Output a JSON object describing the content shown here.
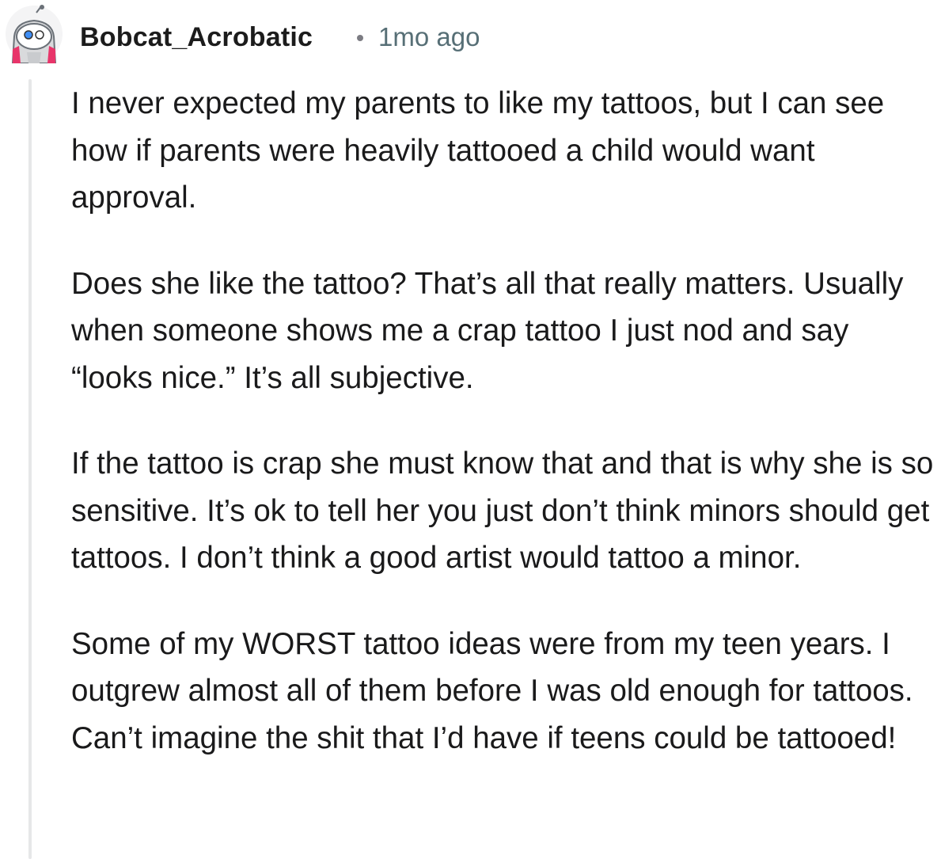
{
  "comment": {
    "username": "Bobcat_Acrobatic",
    "separator": "•",
    "timestamp": "1mo ago",
    "avatar_icon": "snoo-avatar-icon",
    "paragraphs": [
      "I never expected my parents to like my tattoos, but I can see how if parents were heavily tattooed a child would want approval.",
      "Does she like the tattoo? That’s all that really matters. Usually when someone shows me a crap tattoo I just nod and say “looks nice.” It’s all subjective.",
      "If the tattoo is crap she must know that and that is why she is so sensitive. It’s ok to tell her you just don’t think minors should get tattoos. I don’t think a good artist would tattoo a minor.",
      "Some of my WORST tattoo ideas were from my teen years. I outgrew almost all of them before I was old enough for tattoos. Can’t imagine the shit that I’d have if teens could be tattooed!"
    ]
  },
  "colors": {
    "text": "#1a1a1b",
    "meta": "#576f76",
    "thread_line": "#e6e7e8",
    "avatar_accent": "#e8356a"
  }
}
